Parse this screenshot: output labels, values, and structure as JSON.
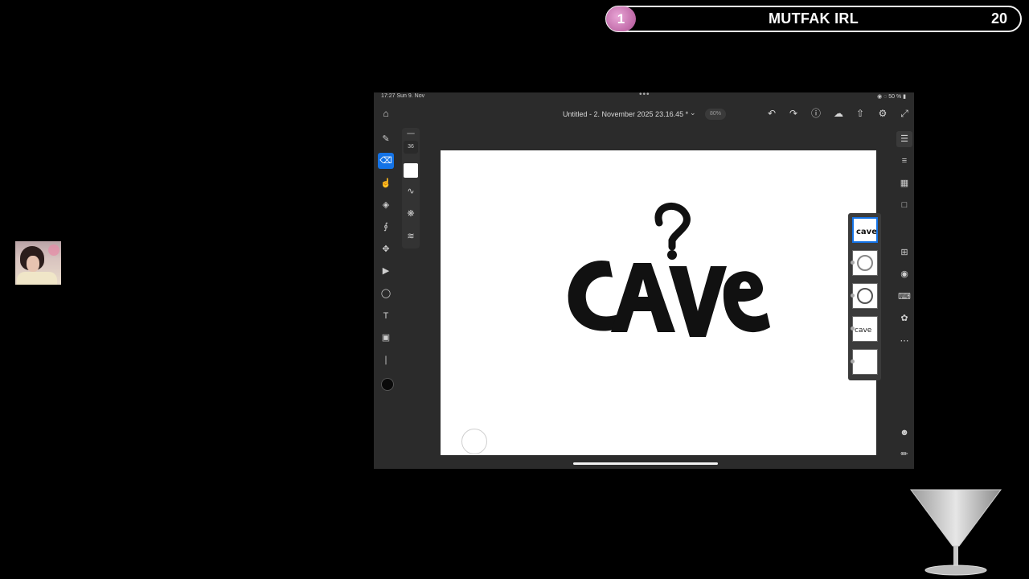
{
  "overlay": {
    "number": "1",
    "title": "MUTFAK IRL",
    "count": "20"
  },
  "ipad": {
    "status": {
      "time": "17:27  Sun 9. Nov",
      "dots": "•••",
      "right": "◉ ◌ 50 % ▮"
    },
    "doc_title": "Untitled - 2. November 2025 23.16.45 *",
    "zoom": "80%",
    "brush_size": "36",
    "canvas_text": "CAVE",
    "layers_count": 5
  }
}
